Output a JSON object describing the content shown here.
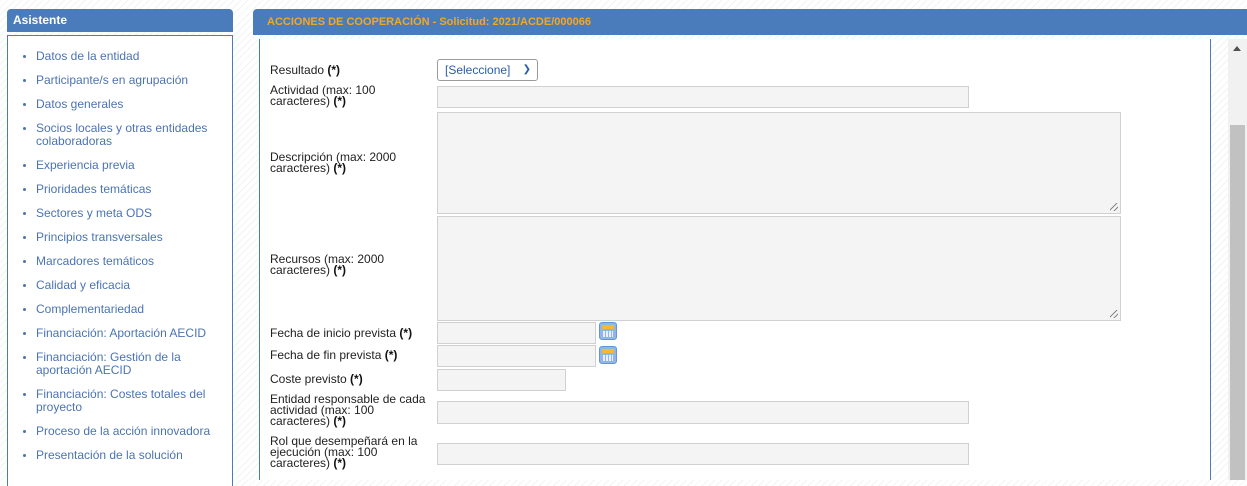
{
  "sidebar": {
    "title": "Asistente",
    "items": [
      "Datos de la entidad",
      "Participante/s en agrupación",
      "Datos generales",
      "Socios locales y otras entidades colaboradoras",
      "Experiencia previa",
      "Prioridades temáticas",
      "Sectores y meta ODS",
      "Principios transversales",
      "Marcadores temáticos",
      "Calidad y eficacia",
      "Complementariedad",
      "Financiación: Aportación AECID",
      "Financiación: Gestión de la aportación AECID",
      "Financiación: Costes totales del proyecto",
      "Proceso de la acción innovadora",
      "Presentación de la solución"
    ]
  },
  "main": {
    "header": "ACCIONES DE COOPERACIÓN - Solicitud: 2021/ACDE/000066"
  },
  "form": {
    "required_mark": "(*)",
    "resultado": {
      "label": "Resultado",
      "value": "[Seleccione]"
    },
    "actividad": {
      "label": "Actividad (max: 100 caracteres)",
      "value": ""
    },
    "descripcion": {
      "label": "Descripción (max: 2000 caracteres)",
      "value": ""
    },
    "recursos": {
      "label": "Recursos (max: 2000 caracteres)",
      "value": ""
    },
    "fecha_inicio": {
      "label": "Fecha de inicio prevista",
      "value": ""
    },
    "fecha_fin": {
      "label": "Fecha de fin prevista",
      "value": ""
    },
    "coste": {
      "label": "Coste previsto",
      "value": ""
    },
    "entidad": {
      "label": "Entidad responsable de cada actividad (max: 100 caracteres)",
      "value": ""
    },
    "rol": {
      "label": "Rol que desempeñará en la ejecución (max: 100 caracteres)",
      "value": ""
    }
  },
  "icons": {
    "calendar": "calendar-icon",
    "dropdown": "chevron-down-icon",
    "scroll_up": "scroll-up-arrow-icon"
  },
  "colors": {
    "header_bg": "#4a7cbc",
    "header_title": "#f5a623",
    "link": "#4b73b3"
  }
}
